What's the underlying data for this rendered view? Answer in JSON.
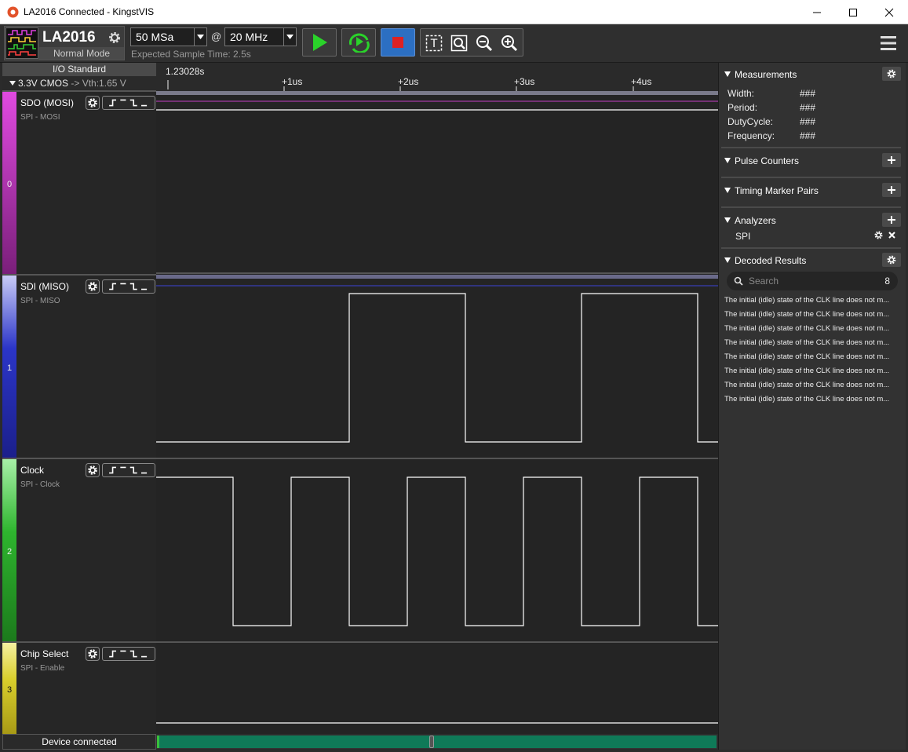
{
  "window": {
    "title": "LA2016 Connected - KingstVIS"
  },
  "toolbar": {
    "device_name": "LA2016",
    "device_mode": "Normal Mode",
    "sample_depth": "50 MSa",
    "at_symbol": "@",
    "sample_rate": "20 MHz",
    "expected_time": "Expected Sample Time: 2.5s",
    "colors": {
      "start": "#2ad32a",
      "stop": "#dd2222",
      "stop_bg": "#2c6fc2"
    }
  },
  "io_standard": {
    "header": "I/O Standard",
    "level": "3.3V CMOS",
    "threshold": "-> Vth:1.65 V"
  },
  "ruler": {
    "origin": "1.23028s",
    "ticks": [
      "+1us",
      "+2us",
      "+3us",
      "+4us"
    ]
  },
  "channels": [
    {
      "index": "0",
      "name": "SDO (MOSI)",
      "sub": "SPI - MOSI",
      "color": "#c53ec5"
    },
    {
      "index": "1",
      "name": "SDI (MISO)",
      "sub": "SPI - MISO",
      "color": "#2b35c8"
    },
    {
      "index": "2",
      "name": "Clock",
      "sub": "SPI - Clock",
      "color": "#2eb52e"
    },
    {
      "index": "3",
      "name": "Chip Select",
      "sub": "SPI - Enable",
      "color": "#d9cf2c"
    }
  ],
  "right_panel": {
    "measurements": {
      "title": "Measurements",
      "rows": [
        {
          "label": "Width:",
          "value": "###"
        },
        {
          "label": "Period:",
          "value": "###"
        },
        {
          "label": "DutyCycle:",
          "value": "###"
        },
        {
          "label": "Frequency:",
          "value": "###"
        }
      ]
    },
    "pulse_counters": {
      "title": "Pulse Counters"
    },
    "timing_markers": {
      "title": "Timing Marker Pairs"
    },
    "analyzers": {
      "title": "Analyzers",
      "items": [
        "SPI"
      ]
    },
    "decoded": {
      "title": "Decoded Results",
      "search_placeholder": "Search",
      "count": "8",
      "results": [
        "The initial (idle) state of the CLK line does not m...",
        "The initial (idle) state of the CLK line does not m...",
        "The initial (idle) state of the CLK line does not m...",
        "The initial (idle) state of the CLK line does not m...",
        "The initial (idle) state of the CLK line does not m...",
        "The initial (idle) state of the CLK line does not m...",
        "The initial (idle) state of the CLK line does not m...",
        "The initial (idle) state of the CLK line does not m..."
      ]
    }
  },
  "status": {
    "text": "Device connected"
  }
}
